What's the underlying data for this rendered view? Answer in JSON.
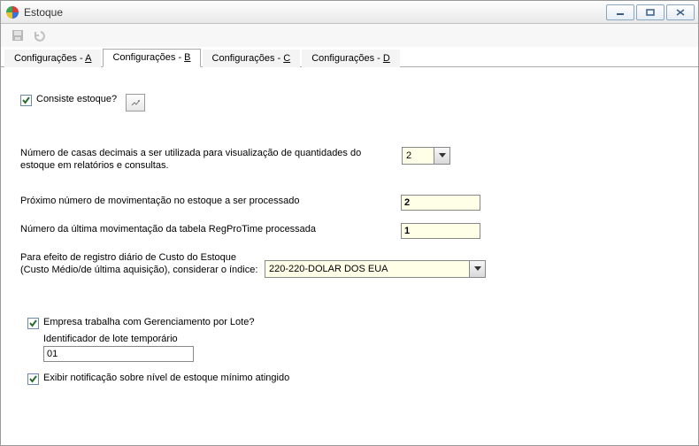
{
  "window": {
    "title": "Estoque"
  },
  "tabs": [
    {
      "label_prefix": "Configurações - ",
      "hotkey": "A"
    },
    {
      "label_prefix": "Configurações - ",
      "hotkey": "B"
    },
    {
      "label_prefix": "Configurações - ",
      "hotkey": "C"
    },
    {
      "label_prefix": "Configurações - ",
      "hotkey": "D"
    }
  ],
  "form": {
    "consiste_label": "Consiste estoque?",
    "consiste_checked": true,
    "decimais_label": "Número de casas decimais a ser utilizada para visualização de quantidades do estoque em relatórios e consultas.",
    "decimais_value": "2",
    "proximo_mov_label": "Próximo número de movimentação no estoque a ser processado",
    "proximo_mov_value": "2",
    "ultima_mov_label": "Número da última movimentação da tabela RegProTime processada",
    "ultima_mov_value": "1",
    "custo_label_line1": "Para efeito de registro diário de Custo do Estoque",
    "custo_label_line2": "(Custo Médio/de última aquisição), considerar o índice:",
    "custo_value": "220-220-DOLAR DOS EUA",
    "lote_label": "Empresa trabalha com Gerenciamento por Lote?",
    "lote_checked": true,
    "lote_id_label": "Identificador de lote temporário",
    "lote_id_value": "01",
    "min_label": "Exibir notificação sobre nível de estoque mínimo atingido",
    "min_checked": true
  }
}
